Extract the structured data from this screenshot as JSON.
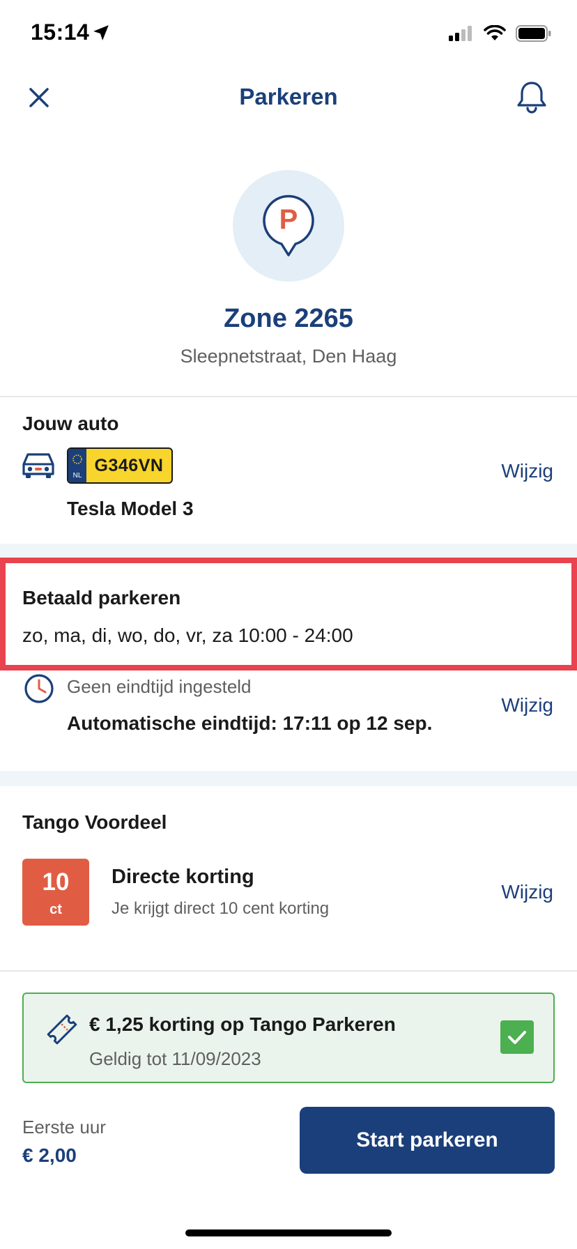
{
  "status_bar": {
    "time": "15:14"
  },
  "header": {
    "title": "Parkeren"
  },
  "zone": {
    "title": "Zone 2265",
    "address": "Sleepnetstraat, Den Haag"
  },
  "car": {
    "section_title": "Jouw auto",
    "plate_country": "NL",
    "plate": "G346VN",
    "model": "Tesla Model 3",
    "edit_label": "Wijzig"
  },
  "paid_parking": {
    "title": "Betaald parkeren",
    "hours": "zo, ma, di, wo, do, vr, za 10:00 - 24:00"
  },
  "end_time": {
    "subtitle": "Geen eindtijd ingesteld",
    "main": "Automatische eindtijd: 17:11 op 12 sep.",
    "edit_label": "Wijzig"
  },
  "advantage": {
    "section_title": "Tango Voordeel",
    "badge_value": "10",
    "badge_unit": "ct",
    "title": "Directe korting",
    "description": "Je krijgt direct 10 cent korting",
    "edit_label": "Wijzig"
  },
  "voucher": {
    "title": "€ 1,25 korting op Tango Parkeren",
    "valid": "Geldig tot 11/09/2023",
    "checked": true
  },
  "footer": {
    "price_label": "Eerste uur",
    "price_value": "€ 2,00",
    "start_label": "Start parkeren"
  },
  "colors": {
    "brand": "#1b3f7a",
    "highlight": "#e8434e",
    "discount": "#e05d44",
    "success": "#4caf50"
  }
}
